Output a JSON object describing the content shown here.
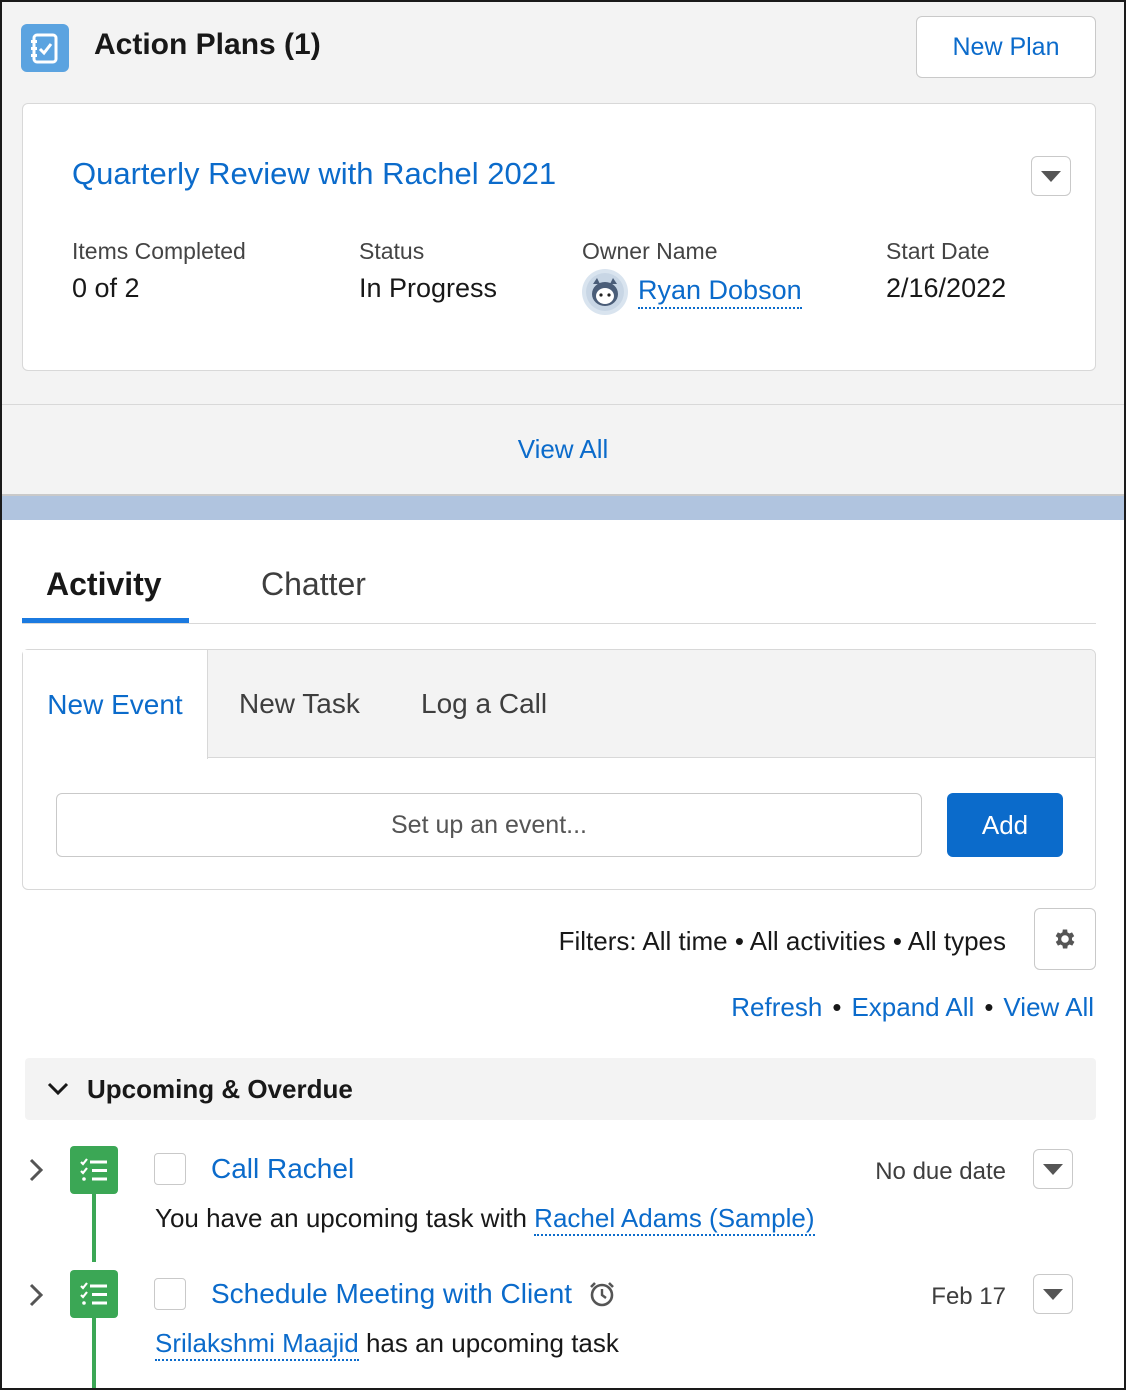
{
  "action_plans": {
    "title": "Action Plans (1)",
    "new_button": "New Plan",
    "record": {
      "title": "Quarterly Review with Rachel 2021",
      "fields": [
        {
          "label": "Items Completed",
          "value": "0 of 2"
        },
        {
          "label": "Status",
          "value": "In Progress"
        },
        {
          "label": "Owner Name",
          "value": "Ryan Dobson"
        },
        {
          "label": "Start Date",
          "value": "2/16/2022"
        }
      ]
    },
    "view_all": "View All"
  },
  "activity": {
    "tabs": [
      "Activity",
      "Chatter"
    ],
    "composer_tabs": [
      "New Event",
      "New Task",
      "Log a Call"
    ],
    "input_placeholder": "Set up an event...",
    "add_button": "Add",
    "filters": {
      "prefix": "Filters:",
      "items": [
        "All time",
        "All activities",
        "All types"
      ]
    },
    "links": [
      "Refresh",
      "Expand All",
      "View All"
    ],
    "section_title": "Upcoming & Overdue",
    "items": [
      {
        "title": "Call Rachel",
        "date": "No due date",
        "desc_prefix": "You have an upcoming task with ",
        "desc_link": "Rachel Adams (Sample)",
        "desc_suffix": ""
      },
      {
        "title": "Schedule Meeting with Client",
        "date": "Feb 17",
        "desc_prefix": "",
        "desc_link": "Srilakshmi Maajid",
        "desc_suffix": " has an upcoming task"
      }
    ]
  },
  "colors": {
    "link": "#0b6bcb",
    "brand_button": "#0b6bcb",
    "task_icon": "#3ba755",
    "action_plan_icon": "#5ba3e0",
    "tab_underline": "#1b7ae0"
  }
}
